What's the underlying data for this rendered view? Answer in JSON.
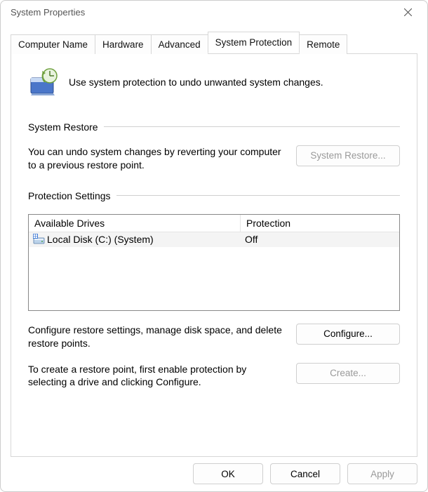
{
  "window": {
    "title": "System Properties"
  },
  "tabs": {
    "computer_name": "Computer Name",
    "hardware": "Hardware",
    "advanced": "Advanced",
    "system_protection": "System Protection",
    "remote": "Remote"
  },
  "intro": {
    "text": "Use system protection to undo unwanted system changes."
  },
  "group_restore": {
    "title": "System Restore",
    "desc": "You can undo system changes by reverting your computer to a previous restore point.",
    "button": "System Restore..."
  },
  "group_protection": {
    "title": "Protection Settings",
    "columns": {
      "drives": "Available Drives",
      "protection": "Protection"
    },
    "rows": [
      {
        "name": "Local Disk (C:) (System)",
        "protection": "Off"
      }
    ],
    "configure_desc": "Configure restore settings, manage disk space, and delete restore points.",
    "configure_button": "Configure...",
    "create_desc": "To create a restore point, first enable protection by selecting a drive and clicking Configure.",
    "create_button": "Create..."
  },
  "footer": {
    "ok": "OK",
    "cancel": "Cancel",
    "apply": "Apply"
  }
}
